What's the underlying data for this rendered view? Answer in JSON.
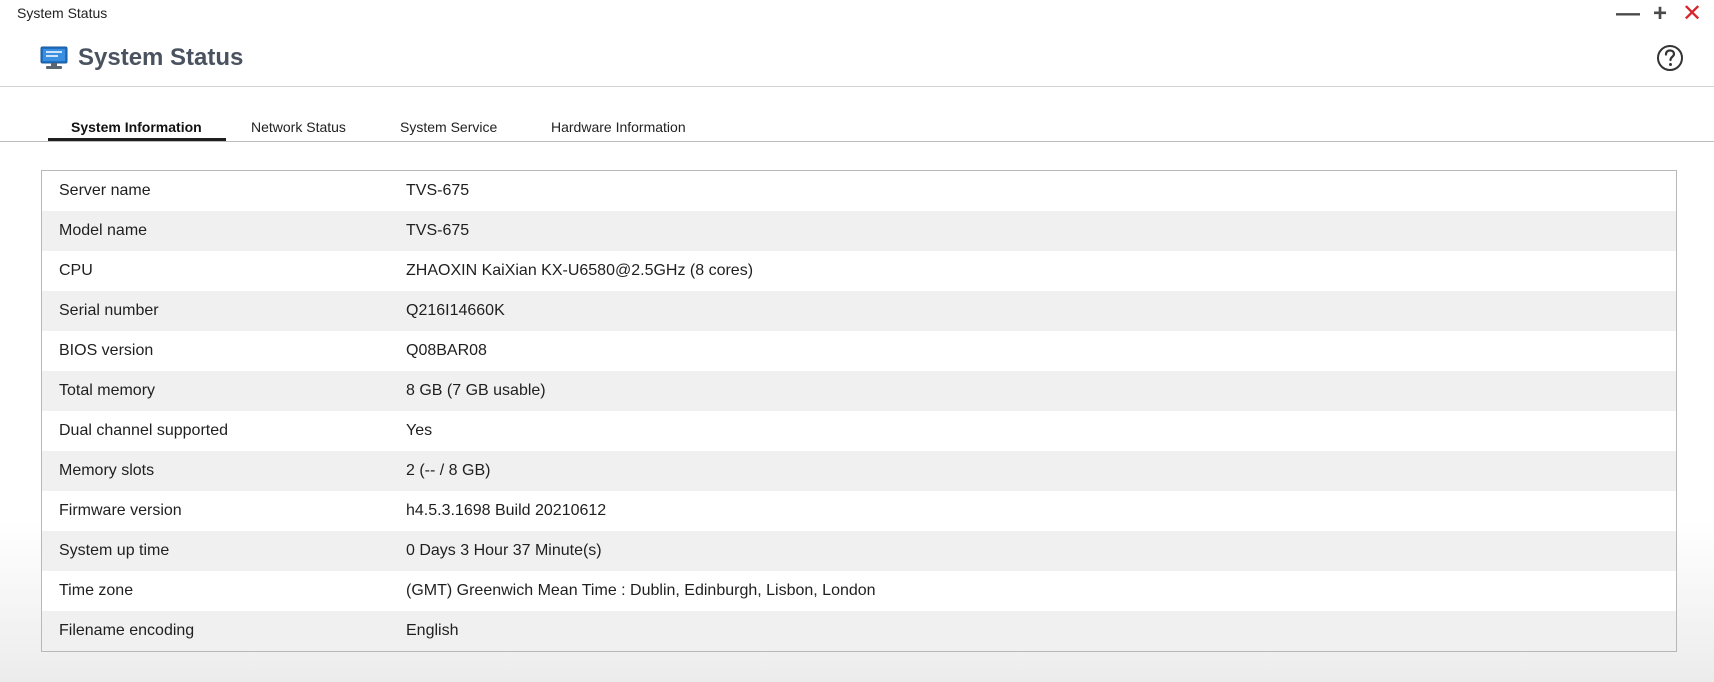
{
  "window": {
    "title": "System Status",
    "close_color": "#d8242b"
  },
  "header": {
    "title": "System Status",
    "app_icon": "monitor-icon",
    "help_icon": "help-icon",
    "title_color": "#4a5260"
  },
  "tabs": [
    {
      "label": "System Information",
      "active": true
    },
    {
      "label": "Network Status",
      "active": false
    },
    {
      "label": "System Service",
      "active": false
    },
    {
      "label": "Hardware Information",
      "active": false
    }
  ],
  "system_info": {
    "rows": [
      {
        "label": "Server name",
        "value": "TVS-675"
      },
      {
        "label": "Model name",
        "value": "TVS-675"
      },
      {
        "label": "CPU",
        "value": "ZHAOXIN KaiXian KX-U6580@2.5GHz (8 cores)"
      },
      {
        "label": "Serial number",
        "value": "Q216I14660K"
      },
      {
        "label": "BIOS version",
        "value": "Q08BAR08"
      },
      {
        "label": "Total memory",
        "value": "8 GB (7 GB usable)"
      },
      {
        "label": "Dual channel supported",
        "value": "Yes"
      },
      {
        "label": "Memory slots",
        "value": "2 (-- / 8 GB)"
      },
      {
        "label": "Firmware version",
        "value": "h4.5.3.1698 Build 20210612"
      },
      {
        "label": "System up time",
        "value": "0 Days 3 Hour 37 Minute(s)"
      },
      {
        "label": "Time zone",
        "value": "(GMT) Greenwich Mean Time : Dublin, Edinburgh, Lisbon, London"
      },
      {
        "label": "Filename encoding",
        "value": "English"
      }
    ]
  }
}
